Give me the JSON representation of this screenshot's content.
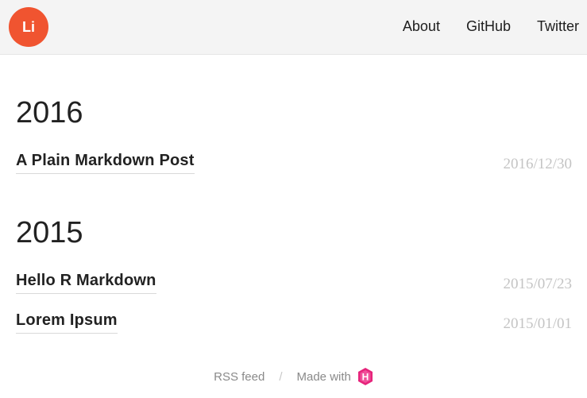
{
  "header": {
    "logo_text": "Li",
    "logo_color": "#f05430",
    "nav": [
      {
        "label": "About"
      },
      {
        "label": "GitHub"
      },
      {
        "label": "Twitter"
      }
    ]
  },
  "archive": [
    {
      "year": "2016",
      "posts": [
        {
          "title": "A Plain Markdown Post",
          "date": "2016/12/30"
        }
      ]
    },
    {
      "year": "2015",
      "posts": [
        {
          "title": "Hello R Markdown",
          "date": "2015/07/23"
        },
        {
          "title": "Lorem Ipsum",
          "date": "2015/01/01"
        }
      ]
    }
  ],
  "footer": {
    "rss_label": "RSS feed",
    "separator": "/",
    "made_with_label": "Made with",
    "made_with_icon": "hugo-logo-icon",
    "made_with_icon_letter": "H",
    "made_with_icon_color": "#e6247b"
  }
}
